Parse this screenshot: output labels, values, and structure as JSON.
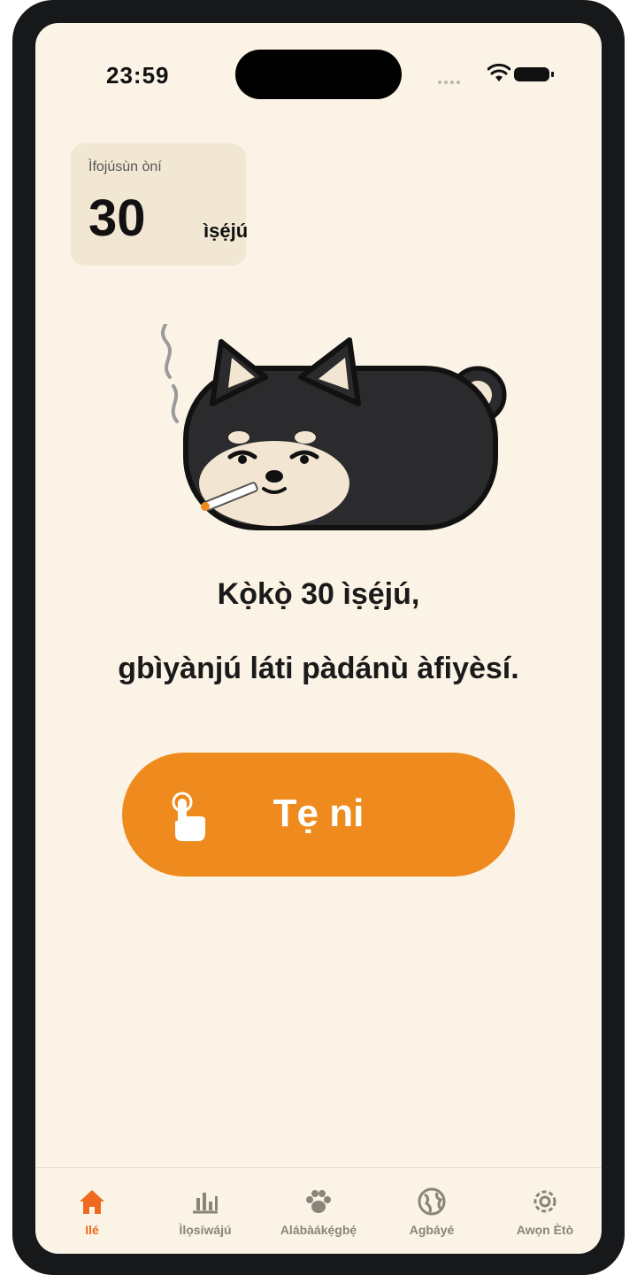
{
  "status_bar": {
    "time": "23:59"
  },
  "focus_card": {
    "label": "Ìfojúsùn òní",
    "value": "30",
    "unit": "ìṣẹ́jú"
  },
  "message": {
    "line1": "Kọ̀kọ̀ 30 ìṣẹ́jú,",
    "line2": "gbìyànjú láti pàdánù àfiyèsí."
  },
  "tap_button": {
    "label": "Tẹ ni",
    "color": "#ef8b1e"
  },
  "tabs": [
    {
      "label": "Ilé",
      "icon": "home-icon",
      "active": true
    },
    {
      "label": "Ìlọsíwájú",
      "icon": "bar-chart-icon",
      "active": false
    },
    {
      "label": "Alábàákẹ́gbẹ́",
      "icon": "paw-icon",
      "active": false
    },
    {
      "label": "Agbáyé",
      "icon": "globe-icon",
      "active": false
    },
    {
      "label": "Awọn Ètò",
      "icon": "gear-icon",
      "active": false
    }
  ],
  "colors": {
    "background": "#faf3e6",
    "accent": "#ef8b1e",
    "active_tab": "#ef6a1e",
    "card": "#f1e7d2"
  }
}
